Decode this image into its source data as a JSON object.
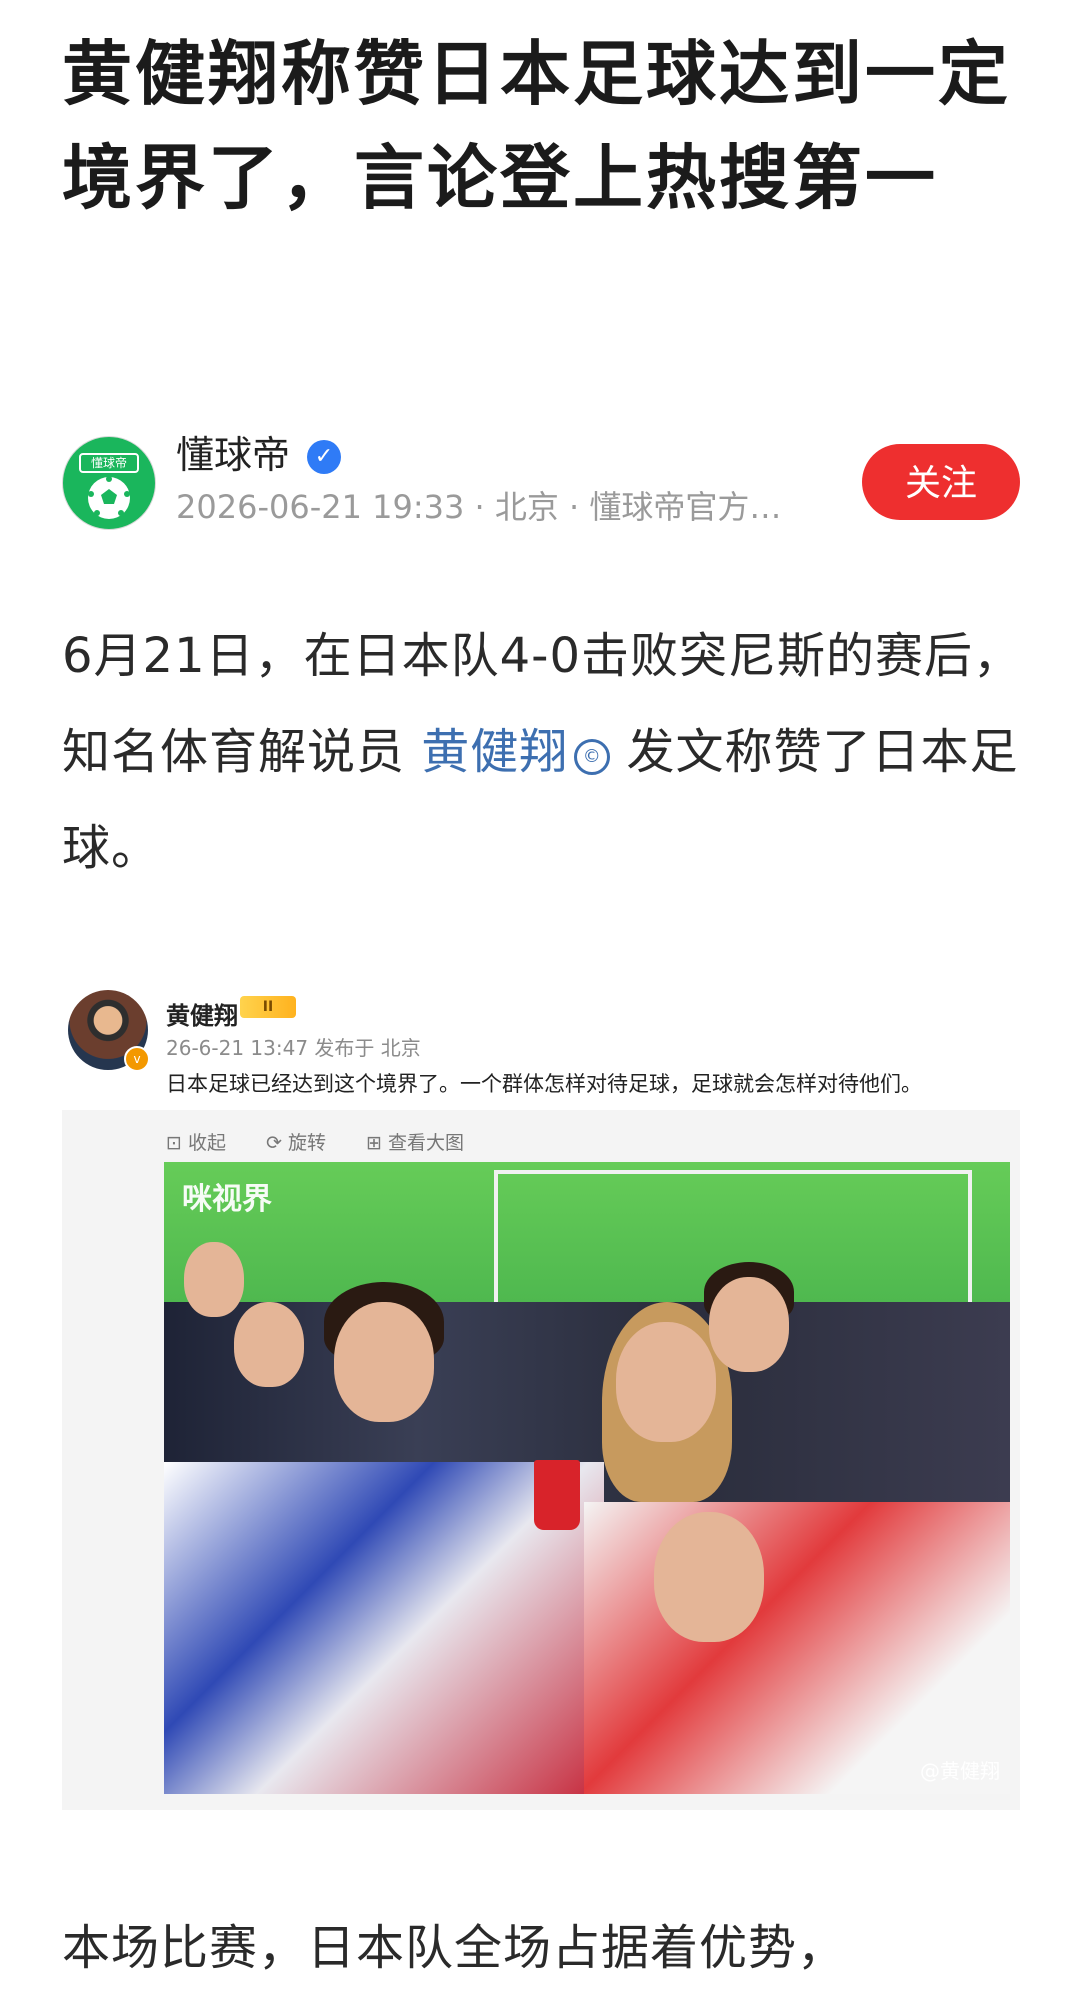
{
  "article": {
    "title": "黄健翔称赞日本足球达到一定境界了，言论登上热搜第一"
  },
  "author": {
    "name": "懂球帝",
    "avatar_text": "懂球帝",
    "verified_icon": "verified-badge-icon",
    "meta": "2026-06-21 19:33 · 北京 · 懂球帝官方…",
    "follow_label": "关注"
  },
  "body": {
    "p1_before": "6月21日，在日本队4-0击败突尼斯的赛后，知名体育解说员 ",
    "p1_link": "黄健翔",
    "p1_after": " 发文称赞了日本足球。",
    "p2_partial": "本场比赛，日本队全场占据着优势，"
  },
  "weibo_card": {
    "name": "黄健翔",
    "vip_label": "II",
    "meta": "26-6-21 13:47  发布于 北京",
    "text": "日本足球已经达到这个境界了。一个群体怎样对待足球，足球就会怎样对待他们。",
    "tools": [
      "收起",
      "旋转",
      "查看大图"
    ],
    "photo_logo": "咪视界",
    "photo_watermark": "@黄健翔"
  },
  "colors": {
    "follow_button": "#ee2f2f",
    "link": "#3d6fb0",
    "verified": "#2f7bf6",
    "avatar_green": "#1ab65c"
  }
}
